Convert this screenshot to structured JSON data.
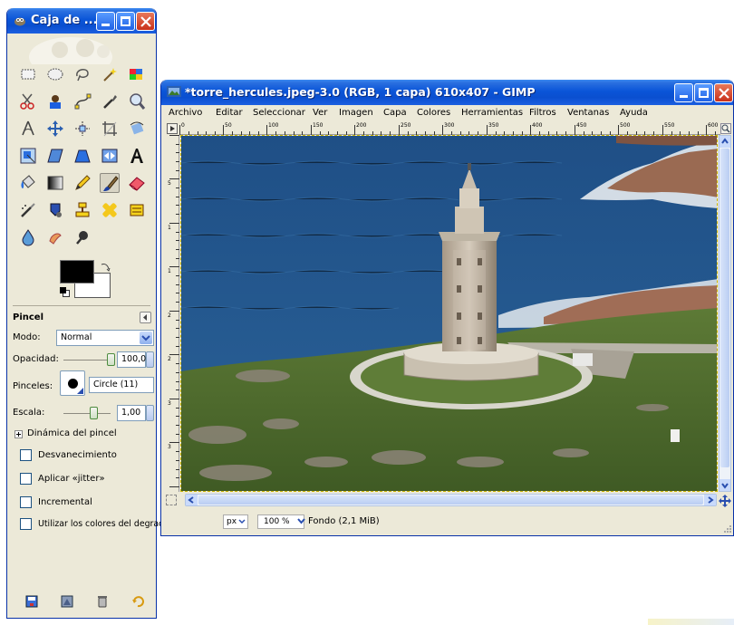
{
  "toolbox": {
    "title": "Caja de ...",
    "brush": {
      "section_title": "Pincel",
      "mode_label": "Modo:",
      "mode_value": "Normal",
      "opacity_label": "Opacidad:",
      "opacity_value": "100,0",
      "brushes_label": "Pinceles:",
      "brush_value": "Circle (11)",
      "scale_label": "Escala:",
      "scale_value": "1,00",
      "dynamics_label": "Dinámica del pincel",
      "fade_label": "Desvanecimiento",
      "jitter_label": "Aplicar «jitter»",
      "incremental_label": "Incremental",
      "gradient_label": "Utilizar los colores del degradado"
    },
    "colors": {
      "foreground": "#000000",
      "background": "#ffffff"
    }
  },
  "image_window": {
    "title": "*torre_hercules.jpeg-3.0 (RGB, 1 capa) 610x407 - GIMP",
    "menu": [
      {
        "label": "Archivo"
      },
      {
        "label": "Editar"
      },
      {
        "label": "Seleccionar"
      },
      {
        "label": "Ver"
      },
      {
        "label": "Imagen"
      },
      {
        "label": "Capa"
      },
      {
        "label": "Colores"
      },
      {
        "label": "Herramientas"
      },
      {
        "label": "Filtros"
      },
      {
        "label": "Ventanas"
      },
      {
        "label": "Ayuda"
      }
    ],
    "ruler_ticks": [
      "0",
      "50",
      "100",
      "150",
      "200",
      "250",
      "300",
      "350",
      "400",
      "450",
      "500",
      "550",
      "600"
    ],
    "vruler_ticks": [
      "0",
      "5",
      "1",
      "1",
      "2",
      "2",
      "3",
      "3"
    ],
    "status": {
      "unit": "px",
      "zoom": "100 %",
      "layer_info": "Fondo (2,1 MiB)"
    }
  },
  "accent_colors": {
    "title_blue": "#0a55d8",
    "close_red": "#c9301a",
    "window_bg": "#ece9d8"
  }
}
